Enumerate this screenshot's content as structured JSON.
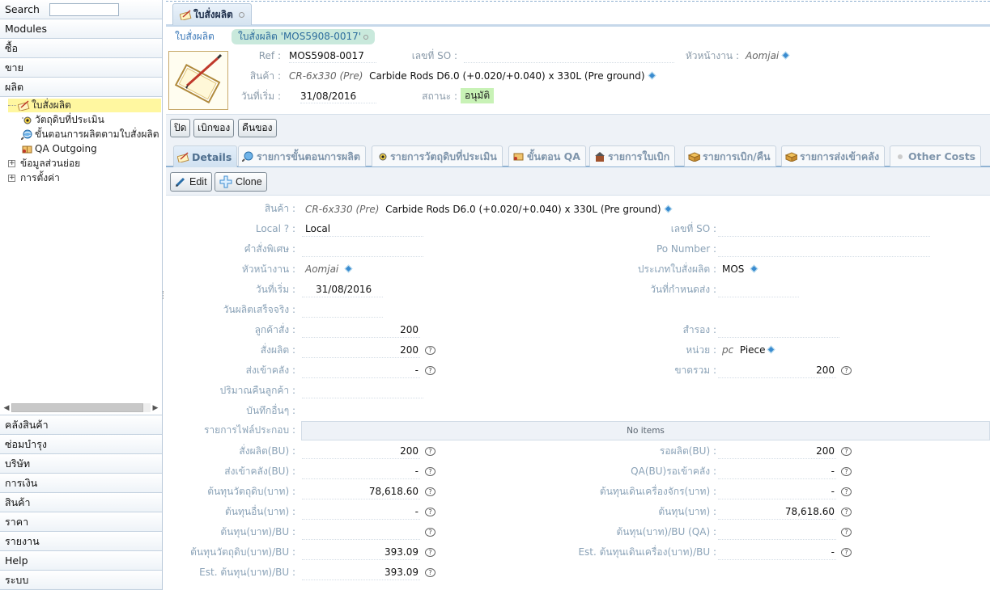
{
  "sidebar": {
    "search_label": "Search",
    "modules_label": "Modules",
    "top_sections": [
      "ซื้อ",
      "ขาย",
      "ผลิต"
    ],
    "tree": [
      {
        "label": "ใบสั่งผลิต",
        "icon": "pencil-document-icon",
        "selected": true
      },
      {
        "label": "วัตถุดิบที่ประเมิน",
        "icon": "eye-icon",
        "selected": false
      },
      {
        "label": "ขั้นตอนการผลิตตามใบสั่งผลิต",
        "icon": "globe-search-icon",
        "selected": false
      },
      {
        "label": "QA Outgoing",
        "icon": "book-icon",
        "selected": false
      },
      {
        "label": "ข้อมูลส่วนย่อย",
        "icon": "plus-box-icon",
        "selected": false
      },
      {
        "label": "การตั้งค่า",
        "icon": "plus-box-icon",
        "selected": false
      }
    ],
    "bottom_sections": [
      "คลังสินค้า",
      "ซ่อมบำรุง",
      "บริษัท",
      "การเงิน",
      "สินค้า",
      "ราคา",
      "รายงาน",
      "Help",
      "ระบบ"
    ]
  },
  "main": {
    "top_tab": "ใบสั่งผลิต",
    "breadcrumb": [
      "ใบสั่งผลิต",
      "ใบสั่งผลิต 'MOS5908-0017'"
    ],
    "header": {
      "ref_label": "Ref :",
      "ref_value": "MOS5908-0017",
      "so_label": "เลขที่ SO :",
      "supervisor_label": "หัวหน้างาน :",
      "supervisor_value": "Aomjai",
      "product_label": "สินค้า :",
      "product_code": "CR-6x330 (Pre)",
      "product_name": "Carbide Rods D6.0 (+0.020/+0.040) x 330L (Pre ground)",
      "start_label": "วันที่เริ่ม :",
      "start_value": "31/08/2016",
      "status_label": "สถานะ :",
      "status_value": "อนุมัติ"
    },
    "actions": [
      "ปิด",
      "เบิกของ",
      "คืนของ"
    ],
    "tabs": [
      {
        "label": "Details",
        "icon": "pencil-document-icon",
        "active": true
      },
      {
        "label": "รายการขั้นตอนการผลิต",
        "icon": "globe-search-icon",
        "active": false
      },
      {
        "label": "รายการวัตถุดิบที่ประเมิน",
        "icon": "eye-icon",
        "active": false
      },
      {
        "label": "ขั้นตอน QA",
        "icon": "book-icon",
        "active": false
      },
      {
        "label": "รายการใบเบิก",
        "icon": "house-icon",
        "active": false
      },
      {
        "label": "รายการเบิก/คืน",
        "icon": "box-icon",
        "active": false
      },
      {
        "label": "รายการส่งเข้าคลัง",
        "icon": "box-icon",
        "active": false
      },
      {
        "label": "Other Costs",
        "icon": "dot-icon",
        "active": false
      }
    ],
    "edit_label": "Edit",
    "clone_label": "Clone",
    "details": {
      "product_label": "สินค้า :",
      "local_label": "Local ? :",
      "local_value": "Local",
      "so_label": "เลขที่ SO :",
      "special_label": "คำสั่งพิเศษ :",
      "po_label": "Po Number :",
      "supervisor_label": "หัวหน้างาน :",
      "mo_type_label": "ประเภทใบสั่งผลิต :",
      "mo_type_value": "MOS",
      "start_label": "วันที่เริ่ม :",
      "due_label": "วันที่กำหนดส่ง :",
      "finished_label": "วันผลิตเสร็จจริง :",
      "customer_order_label": "ลูกค้าสั่ง :",
      "customer_order_value": "200",
      "reserve_label": "สำรอง :",
      "production_order_label": "สั่งผลิต :",
      "production_order_value": "200",
      "unit_label": "หน่วย :",
      "unit_code": "pc",
      "unit_name": "Piece",
      "to_stock_label": "ส่งเข้าคลัง :",
      "to_stock_value": "-",
      "total_short_label": "ขาดรวม :",
      "total_short_value": "200",
      "return_qty_label": "ปริมาณคืนลูกค้า :",
      "note_label": "บันทึกอื่นๆ :",
      "attach_label": "รายการไฟล์ประกอบ :",
      "attach_empty": "No items",
      "rows": [
        {
          "left_label": "สั่งผลิต(BU) :",
          "left_value": "200",
          "left_q": true,
          "right_label": "รอผลิต(BU) :",
          "right_value": "200",
          "right_q": true
        },
        {
          "left_label": "ส่งเข้าคลัง(BU) :",
          "left_value": "-",
          "left_q": true,
          "right_label": "QA(BU)รอเข้าคลัง :",
          "right_value": "-",
          "right_q": true
        },
        {
          "left_label": "ต้นทุนวัตถุดิบ(บาท) :",
          "left_value": "78,618.60",
          "left_q": true,
          "right_label": "ต้นทุนเดินเครื่องจักร(บาท) :",
          "right_value": "-",
          "right_q": true
        },
        {
          "left_label": "ต้นทุนอื่น(บาท) :",
          "left_value": "-",
          "left_q": true,
          "right_label": "ต้นทุน(บาท) :",
          "right_value": "78,618.60",
          "right_q": true
        },
        {
          "left_label": "ต้นทุน(บาท)/BU :",
          "left_value": "",
          "left_q": true,
          "right_label": "ต้นทุน(บาท)/BU (QA) :",
          "right_value": "",
          "right_q": true
        },
        {
          "left_label": "ต้นทุนวัตถุดิบ(บาท)/BU :",
          "left_value": "393.09",
          "left_q": true,
          "right_label": "Est. ต้นทุนเดินเครื่อง(บาท)/BU :",
          "right_value": "-",
          "right_q": true
        },
        {
          "left_label": "Est. ต้นทุน(บาท)/BU :",
          "left_value": "393.09",
          "left_q": true,
          "right_label": "",
          "right_value": "",
          "right_q": false
        }
      ]
    }
  }
}
